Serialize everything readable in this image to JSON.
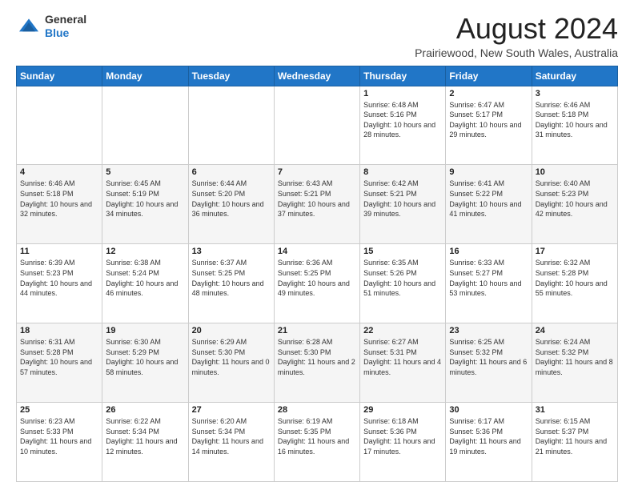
{
  "header": {
    "logo_general": "General",
    "logo_blue": "Blue",
    "month_year": "August 2024",
    "location": "Prairiewood, New South Wales, Australia"
  },
  "days_of_week": [
    "Sunday",
    "Monday",
    "Tuesday",
    "Wednesday",
    "Thursday",
    "Friday",
    "Saturday"
  ],
  "weeks": [
    [
      {
        "day": "",
        "sunrise": "",
        "sunset": "",
        "daylight": ""
      },
      {
        "day": "",
        "sunrise": "",
        "sunset": "",
        "daylight": ""
      },
      {
        "day": "",
        "sunrise": "",
        "sunset": "",
        "daylight": ""
      },
      {
        "day": "",
        "sunrise": "",
        "sunset": "",
        "daylight": ""
      },
      {
        "day": "1",
        "sunrise": "Sunrise: 6:48 AM",
        "sunset": "Sunset: 5:16 PM",
        "daylight": "Daylight: 10 hours and 28 minutes."
      },
      {
        "day": "2",
        "sunrise": "Sunrise: 6:47 AM",
        "sunset": "Sunset: 5:17 PM",
        "daylight": "Daylight: 10 hours and 29 minutes."
      },
      {
        "day": "3",
        "sunrise": "Sunrise: 6:46 AM",
        "sunset": "Sunset: 5:18 PM",
        "daylight": "Daylight: 10 hours and 31 minutes."
      }
    ],
    [
      {
        "day": "4",
        "sunrise": "Sunrise: 6:46 AM",
        "sunset": "Sunset: 5:18 PM",
        "daylight": "Daylight: 10 hours and 32 minutes."
      },
      {
        "day": "5",
        "sunrise": "Sunrise: 6:45 AM",
        "sunset": "Sunset: 5:19 PM",
        "daylight": "Daylight: 10 hours and 34 minutes."
      },
      {
        "day": "6",
        "sunrise": "Sunrise: 6:44 AM",
        "sunset": "Sunset: 5:20 PM",
        "daylight": "Daylight: 10 hours and 36 minutes."
      },
      {
        "day": "7",
        "sunrise": "Sunrise: 6:43 AM",
        "sunset": "Sunset: 5:21 PM",
        "daylight": "Daylight: 10 hours and 37 minutes."
      },
      {
        "day": "8",
        "sunrise": "Sunrise: 6:42 AM",
        "sunset": "Sunset: 5:21 PM",
        "daylight": "Daylight: 10 hours and 39 minutes."
      },
      {
        "day": "9",
        "sunrise": "Sunrise: 6:41 AM",
        "sunset": "Sunset: 5:22 PM",
        "daylight": "Daylight: 10 hours and 41 minutes."
      },
      {
        "day": "10",
        "sunrise": "Sunrise: 6:40 AM",
        "sunset": "Sunset: 5:23 PM",
        "daylight": "Daylight: 10 hours and 42 minutes."
      }
    ],
    [
      {
        "day": "11",
        "sunrise": "Sunrise: 6:39 AM",
        "sunset": "Sunset: 5:23 PM",
        "daylight": "Daylight: 10 hours and 44 minutes."
      },
      {
        "day": "12",
        "sunrise": "Sunrise: 6:38 AM",
        "sunset": "Sunset: 5:24 PM",
        "daylight": "Daylight: 10 hours and 46 minutes."
      },
      {
        "day": "13",
        "sunrise": "Sunrise: 6:37 AM",
        "sunset": "Sunset: 5:25 PM",
        "daylight": "Daylight: 10 hours and 48 minutes."
      },
      {
        "day": "14",
        "sunrise": "Sunrise: 6:36 AM",
        "sunset": "Sunset: 5:25 PM",
        "daylight": "Daylight: 10 hours and 49 minutes."
      },
      {
        "day": "15",
        "sunrise": "Sunrise: 6:35 AM",
        "sunset": "Sunset: 5:26 PM",
        "daylight": "Daylight: 10 hours and 51 minutes."
      },
      {
        "day": "16",
        "sunrise": "Sunrise: 6:33 AM",
        "sunset": "Sunset: 5:27 PM",
        "daylight": "Daylight: 10 hours and 53 minutes."
      },
      {
        "day": "17",
        "sunrise": "Sunrise: 6:32 AM",
        "sunset": "Sunset: 5:28 PM",
        "daylight": "Daylight: 10 hours and 55 minutes."
      }
    ],
    [
      {
        "day": "18",
        "sunrise": "Sunrise: 6:31 AM",
        "sunset": "Sunset: 5:28 PM",
        "daylight": "Daylight: 10 hours and 57 minutes."
      },
      {
        "day": "19",
        "sunrise": "Sunrise: 6:30 AM",
        "sunset": "Sunset: 5:29 PM",
        "daylight": "Daylight: 10 hours and 58 minutes."
      },
      {
        "day": "20",
        "sunrise": "Sunrise: 6:29 AM",
        "sunset": "Sunset: 5:30 PM",
        "daylight": "Daylight: 11 hours and 0 minutes."
      },
      {
        "day": "21",
        "sunrise": "Sunrise: 6:28 AM",
        "sunset": "Sunset: 5:30 PM",
        "daylight": "Daylight: 11 hours and 2 minutes."
      },
      {
        "day": "22",
        "sunrise": "Sunrise: 6:27 AM",
        "sunset": "Sunset: 5:31 PM",
        "daylight": "Daylight: 11 hours and 4 minutes."
      },
      {
        "day": "23",
        "sunrise": "Sunrise: 6:25 AM",
        "sunset": "Sunset: 5:32 PM",
        "daylight": "Daylight: 11 hours and 6 minutes."
      },
      {
        "day": "24",
        "sunrise": "Sunrise: 6:24 AM",
        "sunset": "Sunset: 5:32 PM",
        "daylight": "Daylight: 11 hours and 8 minutes."
      }
    ],
    [
      {
        "day": "25",
        "sunrise": "Sunrise: 6:23 AM",
        "sunset": "Sunset: 5:33 PM",
        "daylight": "Daylight: 11 hours and 10 minutes."
      },
      {
        "day": "26",
        "sunrise": "Sunrise: 6:22 AM",
        "sunset": "Sunset: 5:34 PM",
        "daylight": "Daylight: 11 hours and 12 minutes."
      },
      {
        "day": "27",
        "sunrise": "Sunrise: 6:20 AM",
        "sunset": "Sunset: 5:34 PM",
        "daylight": "Daylight: 11 hours and 14 minutes."
      },
      {
        "day": "28",
        "sunrise": "Sunrise: 6:19 AM",
        "sunset": "Sunset: 5:35 PM",
        "daylight": "Daylight: 11 hours and 16 minutes."
      },
      {
        "day": "29",
        "sunrise": "Sunrise: 6:18 AM",
        "sunset": "Sunset: 5:36 PM",
        "daylight": "Daylight: 11 hours and 17 minutes."
      },
      {
        "day": "30",
        "sunrise": "Sunrise: 6:17 AM",
        "sunset": "Sunset: 5:36 PM",
        "daylight": "Daylight: 11 hours and 19 minutes."
      },
      {
        "day": "31",
        "sunrise": "Sunrise: 6:15 AM",
        "sunset": "Sunset: 5:37 PM",
        "daylight": "Daylight: 11 hours and 21 minutes."
      }
    ]
  ]
}
